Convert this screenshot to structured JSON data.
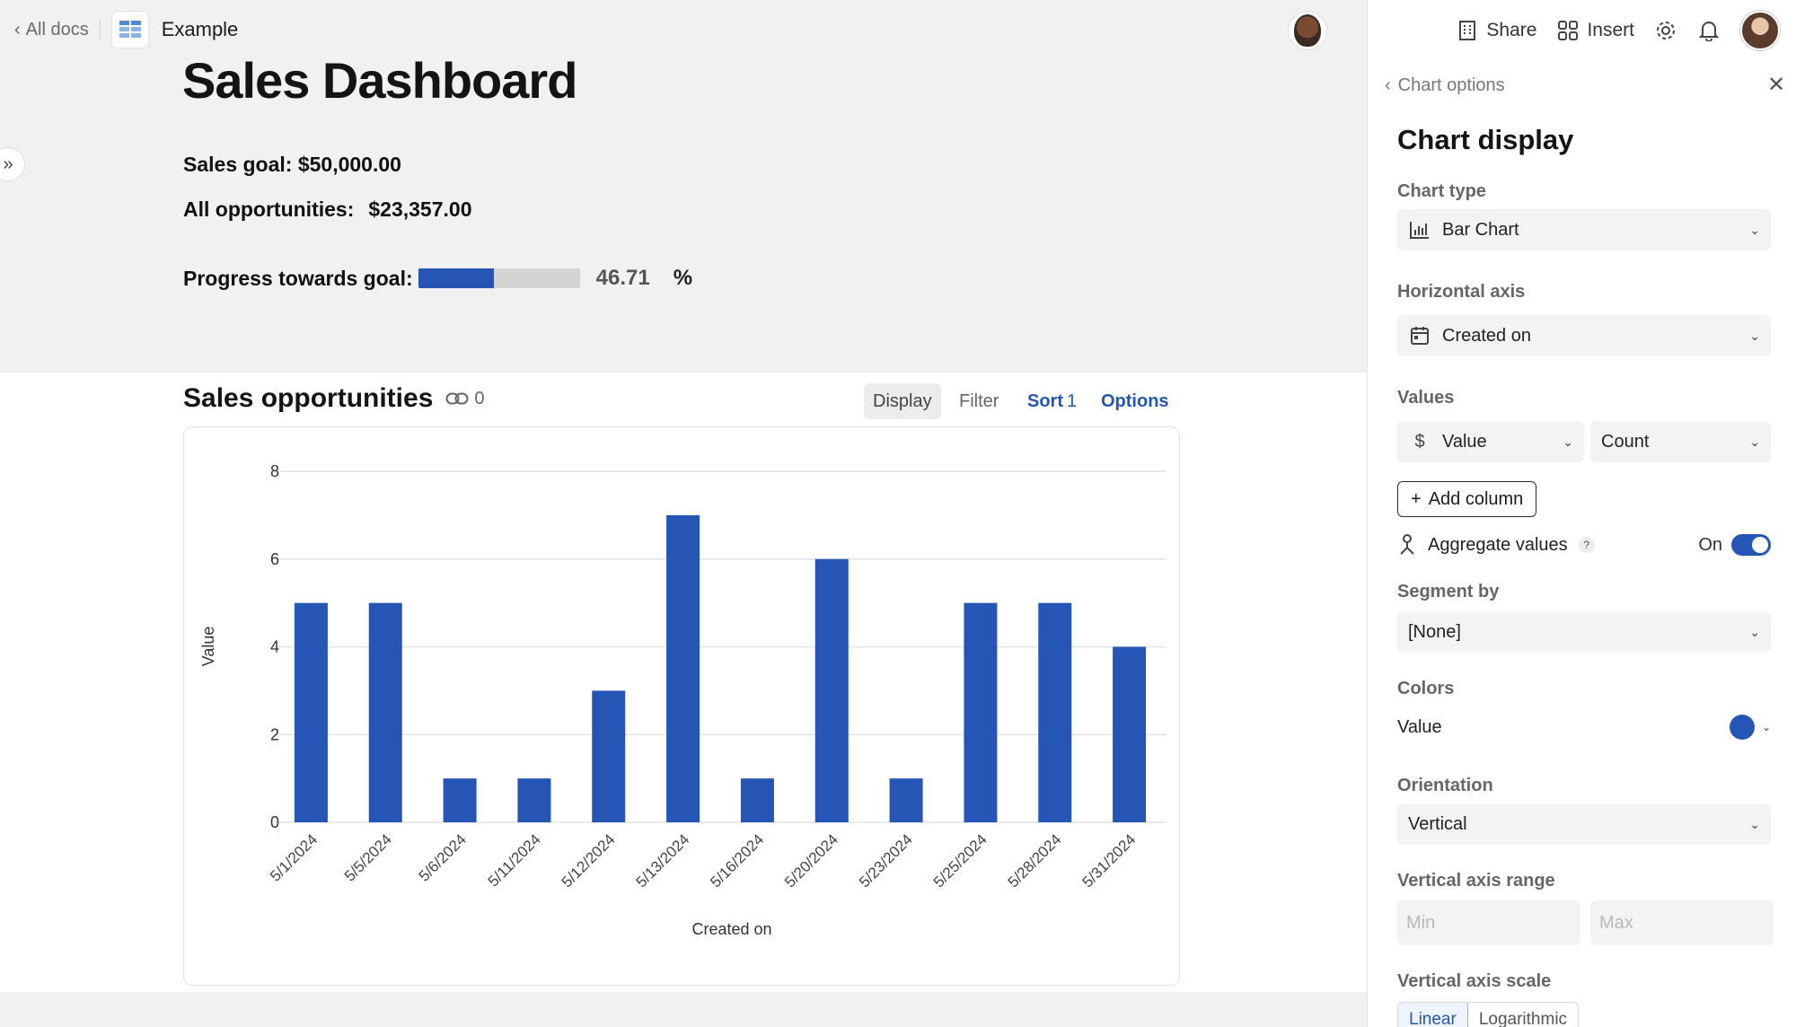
{
  "topbar": {
    "back_label": "All docs",
    "doc_name": "Example",
    "share_label": "Share",
    "insert_label": "Insert"
  },
  "page": {
    "title": "Sales Dashboard",
    "sales_goal": "Sales goal: $50,000.00",
    "all_opps_label": "All opportunities:",
    "all_opps_value": "$23,357.00",
    "progress_label": "Progress towards goal:",
    "progress_fraction": 0.4671,
    "progress_value": "46.71",
    "progress_unit": "%"
  },
  "table": {
    "title": "Sales opportunities",
    "link_count": "0",
    "display_label": "Display",
    "filter_label": "Filter",
    "sort_label": "Sort",
    "sort_count": "1",
    "options_label": "Options"
  },
  "chart_data": {
    "type": "bar",
    "categories": [
      "5/1/2024",
      "5/5/2024",
      "5/6/2024",
      "5/11/2024",
      "5/12/2024",
      "5/13/2024",
      "5/16/2024",
      "5/20/2024",
      "5/23/2024",
      "5/25/2024",
      "5/28/2024",
      "5/31/2024"
    ],
    "values": [
      5,
      5,
      1,
      1,
      3,
      7,
      1,
      6,
      1,
      5,
      5,
      4
    ],
    "xlabel": "Created on",
    "ylabel": "Value",
    "ylim": [
      0,
      8
    ],
    "yticks": [
      0,
      2,
      4,
      6,
      8
    ],
    "grid": true,
    "color": "#2556b6"
  },
  "panel": {
    "back_label": "Chart options",
    "title": "Chart display",
    "chart_type_label": "Chart type",
    "chart_type_value": "Bar Chart",
    "haxis_label": "Horizontal axis",
    "haxis_value": "Created on",
    "values_label": "Values",
    "values_column": "Value",
    "values_agg": "Count",
    "add_column_label": "Add column",
    "aggregate_label": "Aggregate values",
    "aggregate_help": "?",
    "aggregate_state": "On",
    "segment_label": "Segment by",
    "segment_value": "[None]",
    "colors_label": "Colors",
    "colors_series": "Value",
    "series_color": "#2556b6",
    "orientation_label": "Orientation",
    "orientation_value": "Vertical",
    "vrange_label": "Vertical axis range",
    "min_placeholder": "Min",
    "max_placeholder": "Max",
    "vscale_label": "Vertical axis scale",
    "scale_linear": "Linear",
    "scale_log": "Logarithmic"
  }
}
